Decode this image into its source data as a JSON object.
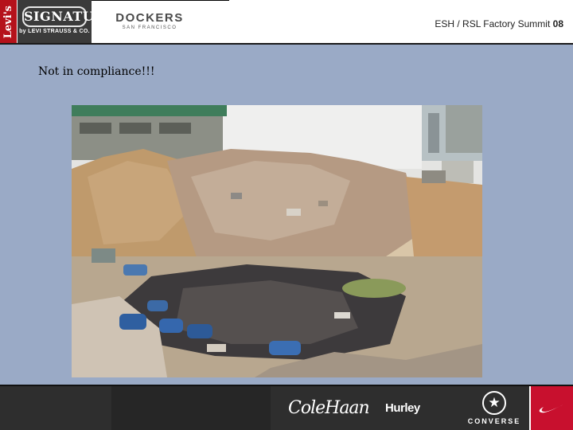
{
  "header": {
    "levis_logo_text": "Levi's",
    "signature_logo": {
      "main": "SIGNATURE",
      "sub": "by LEVI STRAUSS & CO."
    },
    "dockers_logo": {
      "main": "DOCKERS",
      "sub": "SAN FRANCISCO"
    },
    "title_text": "ESH / RSL Factory Summit ",
    "title_year": "08"
  },
  "slide": {
    "heading": "Not in compliance!!!",
    "photo_icon": "construction-debris-photo"
  },
  "footer": {
    "cole_haan_logo": "ColeHaan",
    "hurley_logo": "Hurley",
    "converse_logo": {
      "star": "★",
      "word": "CONVERSE"
    },
    "nike_logo_icon": "swoosh-icon"
  },
  "colors": {
    "slide_background": "#9aaac6",
    "footer_background": "#2e2e2e",
    "levis_red": "#b5121b",
    "nike_red": "#c8102e"
  }
}
